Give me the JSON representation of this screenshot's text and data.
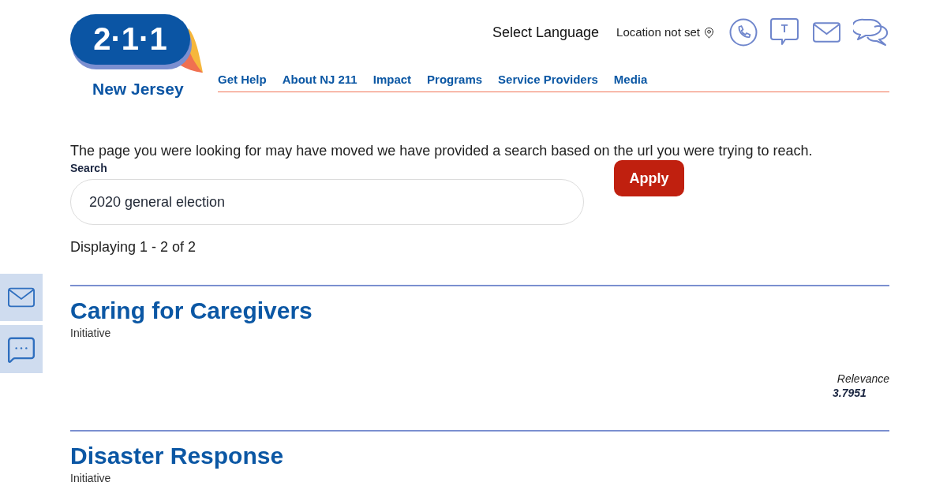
{
  "header": {
    "logo": {
      "number": "2·1·1",
      "region": "New Jersey"
    },
    "language": "Select Language",
    "location": "Location not set",
    "text_button": "T"
  },
  "nav": [
    {
      "label": "Get Help"
    },
    {
      "label": "About NJ 211"
    },
    {
      "label": "Impact"
    },
    {
      "label": "Programs"
    },
    {
      "label": "Service Providers"
    },
    {
      "label": "Media"
    }
  ],
  "notice": "The page you were looking for may have moved we have provided a search based on the url you were trying to reach.",
  "search": {
    "label": "Search",
    "value": "2020 general election",
    "button": "Apply"
  },
  "result_count": "Displaying 1 - 2 of 2",
  "results": [
    {
      "title": "Caring for Caregivers",
      "type": "Initiative",
      "relevance_label": "Relevance",
      "relevance": "3.7951"
    },
    {
      "title": "Disaster Response",
      "type": "Initiative"
    }
  ]
}
